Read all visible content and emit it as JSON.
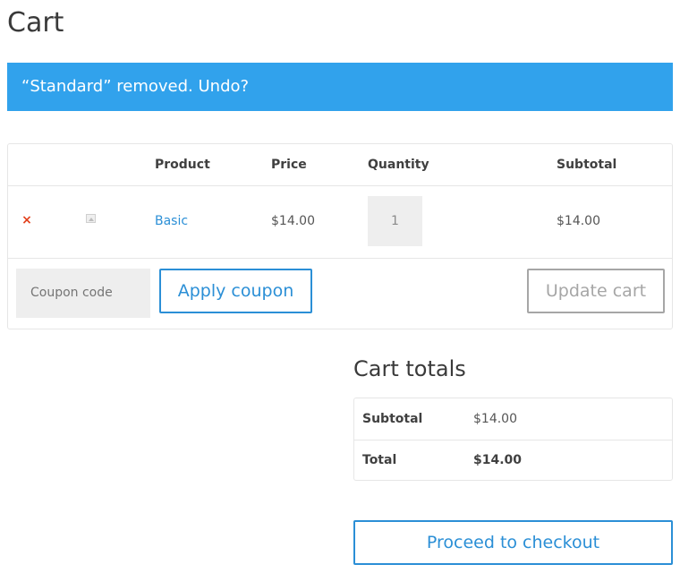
{
  "page": {
    "title": "Cart"
  },
  "notice": {
    "text": "“Standard” removed.",
    "undo_label": "Undo?"
  },
  "cart_table": {
    "headers": {
      "product": "Product",
      "price": "Price",
      "quantity": "Quantity",
      "subtotal": "Subtotal"
    },
    "rows": [
      {
        "remove_icon": "×",
        "product": "Basic",
        "price": "$14.00",
        "quantity": "1",
        "subtotal": "$14.00"
      }
    ]
  },
  "actions": {
    "coupon_placeholder": "Coupon code",
    "apply_coupon_label": "Apply coupon",
    "update_cart_label": "Update cart"
  },
  "totals": {
    "title": "Cart totals",
    "subtotal_label": "Subtotal",
    "subtotal_value": "$14.00",
    "total_label": "Total",
    "total_value": "$14.00"
  },
  "checkout": {
    "label": "Proceed to checkout"
  },
  "colors": {
    "notice_background": "#31a2ec",
    "accent": "#2b8fd6",
    "remove": "#e2401c",
    "disabled_button": "#a6a6a6"
  },
  "icons": {
    "remove": "close-icon",
    "thumbnail": "image-placeholder-icon"
  }
}
